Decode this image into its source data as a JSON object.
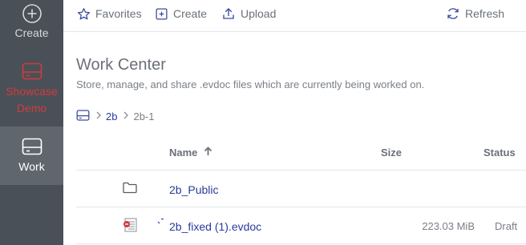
{
  "sidebar": {
    "items": [
      {
        "label": "Create",
        "icon": "plus-circle-icon"
      },
      {
        "label": "Showcase Demo",
        "icon": "drive-icon",
        "color": "#d23b3b"
      },
      {
        "label": "Work",
        "icon": "drive-icon",
        "active": true
      }
    ]
  },
  "toolbar": {
    "favorites_label": "Favorites",
    "create_label": "Create",
    "upload_label": "Upload",
    "refresh_label": "Refresh"
  },
  "header": {
    "title": "Work Center",
    "subtitle": "Store, manage, and share .evdoc files which are currently being worked on."
  },
  "breadcrumb": {
    "root_icon": "drive-icon",
    "items": [
      "2b",
      "2b-1"
    ]
  },
  "table": {
    "columns": {
      "name": "Name",
      "size": "Size",
      "status": "Status"
    },
    "sort": {
      "column": "Name",
      "direction": "ascending"
    },
    "rows": [
      {
        "type": "folder",
        "icon": "folder-icon",
        "name": "2b_Public",
        "size": "",
        "status": ""
      },
      {
        "type": "file",
        "icon": "evdoc-file-icon",
        "name": "2b_fixed (1).evdoc",
        "size": "223.03 MiB",
        "status": "Draft"
      }
    ]
  },
  "colors": {
    "sidebar_bg": "#4a5058",
    "sidebar_active_bg": "#5f666e",
    "accent_red": "#d23b3b",
    "link_blue": "#2b3a9a"
  }
}
